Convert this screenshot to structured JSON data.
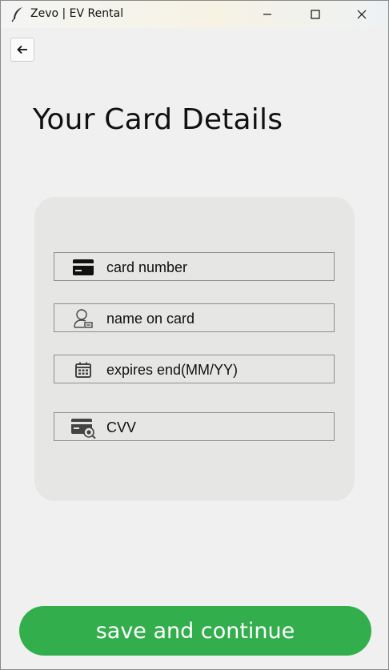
{
  "window": {
    "title": "Zevo | EV Rental",
    "app_icon": "feather-icon",
    "controls": [
      "minimize-icon",
      "maximize-icon",
      "close-icon"
    ]
  },
  "nav": {
    "back_icon": "arrow-left-icon",
    "back_symbol": "←"
  },
  "page": {
    "title": "Your Card Details"
  },
  "form": {
    "fields": [
      {
        "icon": "credit-card-icon",
        "placeholder": "card number"
      },
      {
        "icon": "user-badge-icon",
        "placeholder": "name on card"
      },
      {
        "icon": "calendar-icon",
        "placeholder": "expires end(MM/YY)"
      },
      {
        "icon": "card-security-icon",
        "placeholder": "CVV"
      }
    ]
  },
  "actions": {
    "save_label": "save and continue"
  },
  "colors": {
    "accent": "#33ae4c",
    "panel": "#e6e6e4",
    "background": "#f0f0f0"
  }
}
